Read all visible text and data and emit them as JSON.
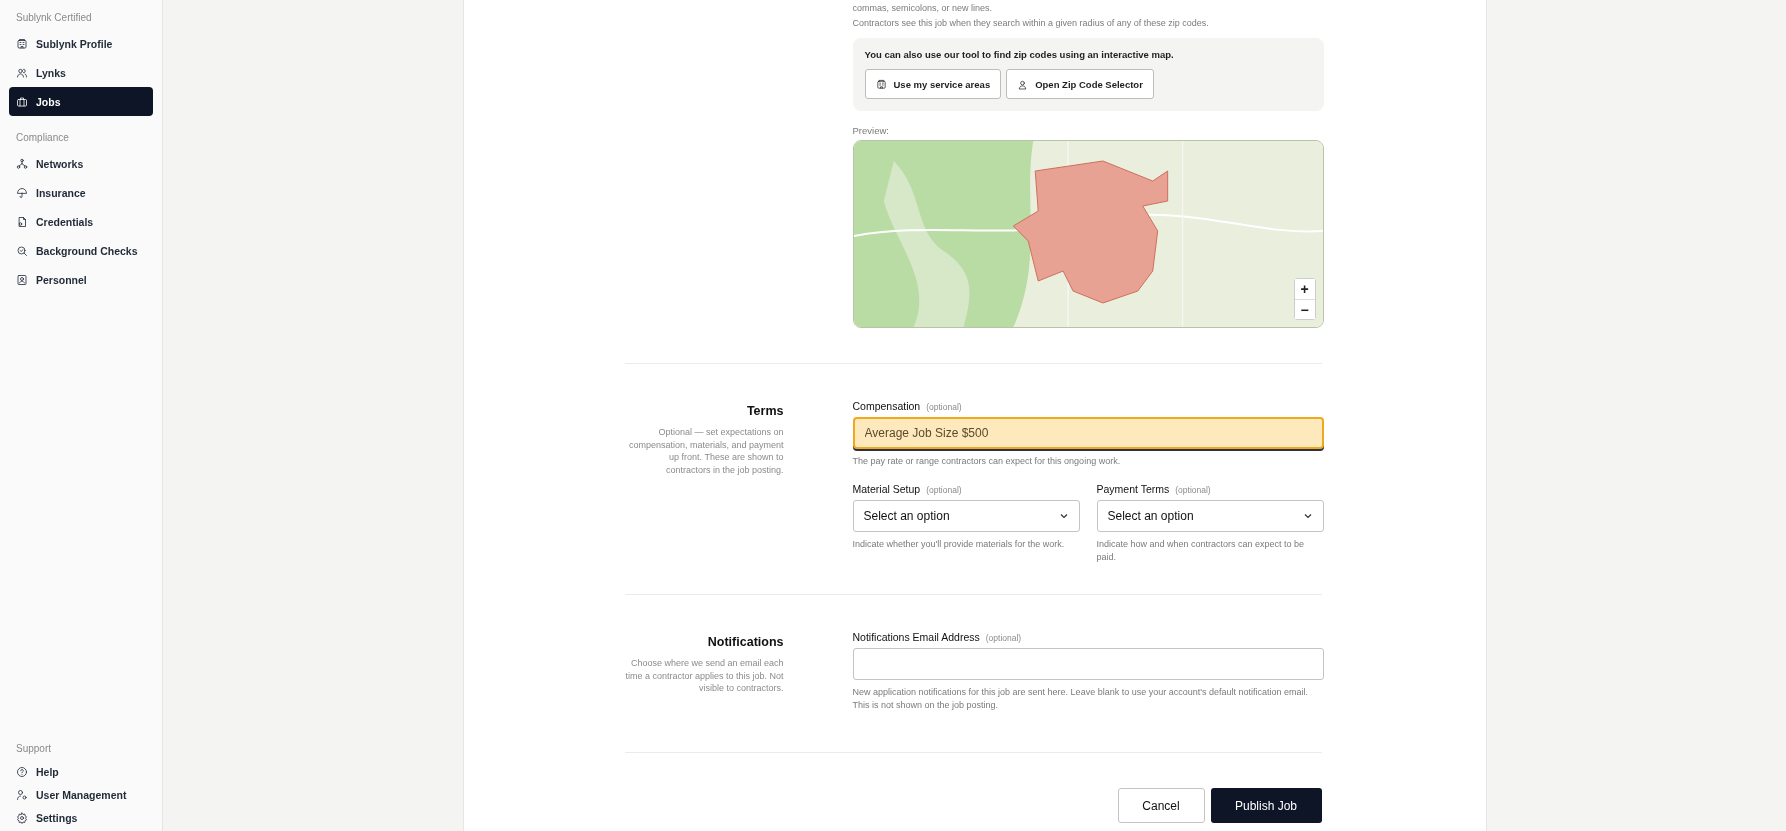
{
  "sidebar": {
    "sections": [
      {
        "heading": "Sublynk Certified",
        "items": [
          {
            "label": "Sublynk Profile",
            "selected": false
          },
          {
            "label": "Lynks",
            "selected": false
          },
          {
            "label": "Jobs",
            "selected": true
          }
        ]
      },
      {
        "heading": "Compliance",
        "items": [
          {
            "label": "Networks",
            "selected": false
          },
          {
            "label": "Insurance",
            "selected": false
          },
          {
            "label": "Credentials",
            "selected": false
          },
          {
            "label": "Background Checks",
            "selected": false
          },
          {
            "label": "Personnel",
            "selected": false
          }
        ]
      },
      {
        "heading": "Support",
        "items": [
          {
            "label": "Help",
            "selected": false
          },
          {
            "label": "User Management",
            "selected": false
          },
          {
            "label": "Settings",
            "selected": false
          }
        ]
      }
    ]
  },
  "zip_section": {
    "hints": [
      "commas, semicolons, or new lines.",
      "Contractors see this job when they search within a given radius of any of these zip codes."
    ],
    "tool_box": {
      "text": "You can also use our tool to find zip codes using an interactive map.",
      "buttons": [
        "Use my service areas",
        "Open Zip Code Selector"
      ]
    },
    "preview_label": "Preview:",
    "map_controls": [
      "+",
      "−"
    ]
  },
  "terms": {
    "title": "Terms",
    "description": "Optional — set expectations on compensation, materials, and payment up front. These are shown to contractors in the job posting.",
    "compensation": {
      "label": "Compensation",
      "note": "(optional)",
      "value": "Average Job Size $500",
      "highlighted": true,
      "hint": "The pay rate or range contractors can expect for this ongoing work."
    },
    "selects": [
      {
        "label": "Material Setup",
        "note": "(optional)",
        "value": "Select an option",
        "hint": "Indicate whether you'll provide materials for the work."
      },
      {
        "label": "Payment Terms",
        "note": "(optional)",
        "value": "Select an option",
        "hint": "Indicate how and when contractors can expect to be paid."
      }
    ]
  },
  "notifications": {
    "title": "Notifications",
    "description": "Choose where we send an email each time a contractor applies to this job. Not visible to contractors.",
    "email": {
      "label": "Notifications Email Address",
      "note": "(optional)",
      "hint": "New application notifications for this job are sent here. Leave blank to use your account's default notification email. This is not shown on the job posting."
    }
  },
  "actions": {
    "cancel": "Cancel",
    "publish": "Publish Job"
  }
}
